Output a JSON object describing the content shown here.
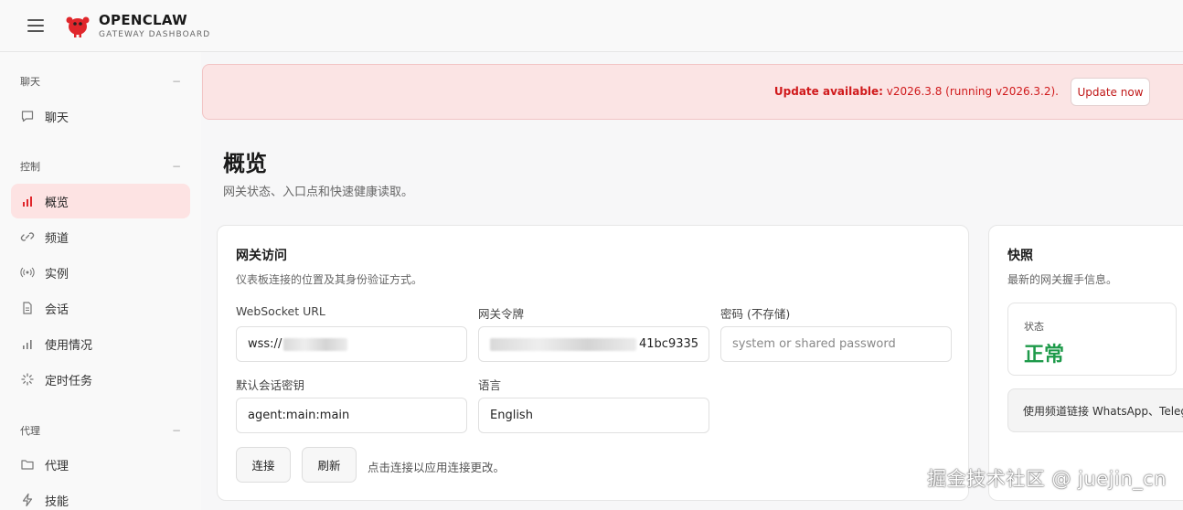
{
  "header": {
    "brand_title": "OPENCLAW",
    "brand_subtitle": "GATEWAY DASHBOARD",
    "logo_icon": "lobster-icon",
    "accent": "#e0262b"
  },
  "sidebar": {
    "sections": [
      {
        "title": "聊天",
        "collapse": "−",
        "items": [
          {
            "label": "聊天",
            "icon": "chat-icon"
          }
        ]
      },
      {
        "title": "控制",
        "collapse": "−",
        "items": [
          {
            "label": "概览",
            "icon": "bar-chart-icon",
            "active": true
          },
          {
            "label": "频道",
            "icon": "link-icon"
          },
          {
            "label": "实例",
            "icon": "broadcast-icon"
          },
          {
            "label": "会话",
            "icon": "document-icon"
          },
          {
            "label": "使用情况",
            "icon": "usage-chart-icon"
          },
          {
            "label": "定时任务",
            "icon": "spinner-icon"
          }
        ]
      },
      {
        "title": "代理",
        "collapse": "−",
        "items": [
          {
            "label": "代理",
            "icon": "folder-icon"
          },
          {
            "label": "技能",
            "icon": "lightning-icon"
          }
        ]
      }
    ]
  },
  "update": {
    "label": "Update available:",
    "detail": "v2026.3.8 (running v2026.3.2).",
    "button": "Update now"
  },
  "page": {
    "title": "概览",
    "subtitle": "网关状态、入口点和快速健康读取。"
  },
  "gateway_card": {
    "title": "网关访问",
    "subtitle": "仪表板连接的位置及其身份验证方式。",
    "ws_label": "WebSocket URL",
    "ws_value": "wss://",
    "token_label": "网关令牌",
    "token_visible_tail": "41bc9335",
    "password_label": "密码 (不存储)",
    "password_placeholder": "system or shared password",
    "session_label": "默认会话密钥",
    "session_value": "agent:main:main",
    "language_label": "语言",
    "language_value": "English",
    "connect_button": "连接",
    "refresh_button": "刷新",
    "hint": "点击连接以应用连接更改。"
  },
  "snapshot_card": {
    "title": "快照",
    "subtitle": "最新的网关握手信息。",
    "status_label": "状态",
    "status_value": "正常",
    "status_color": "#1e9a4a",
    "info": "使用频道链接 WhatsApp、Teleg"
  },
  "watermark": "掘金技术社区 @ juejin_cn"
}
